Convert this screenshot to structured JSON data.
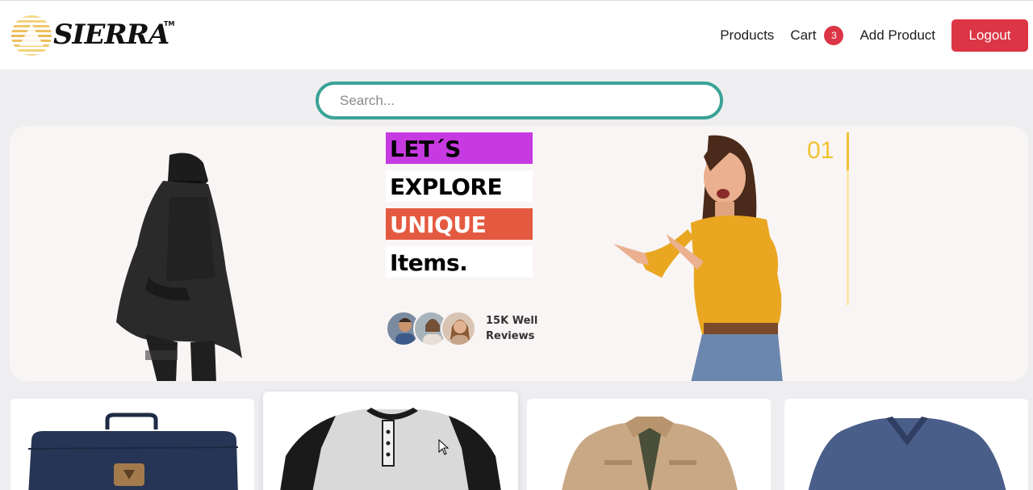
{
  "brand": {
    "name": "SIERRA",
    "tm": "TM"
  },
  "nav": {
    "products": "Products",
    "cart": "Cart",
    "cart_count": "3",
    "add_product": "Add Product",
    "logout": "Logout"
  },
  "search": {
    "placeholder": "Search..."
  },
  "hero": {
    "words": [
      "LET´S",
      "EXPLORE",
      "UNIQUE",
      "Items."
    ],
    "reviews_line1": "15K Well",
    "reviews_line2": "Reviews",
    "slide_number": "01"
  },
  "products": [
    {
      "image": "navy-backpack"
    },
    {
      "image": "raglan-henley-shirt"
    },
    {
      "image": "khaki-jacket"
    },
    {
      "image": "blue-vneck-sweater"
    }
  ],
  "colors": {
    "accent_red": "#dc3545",
    "search_border": "#3aa396",
    "hero_purple": "#c73ae2",
    "hero_orange": "#e45a40",
    "slide_yellow": "#f1c232"
  }
}
